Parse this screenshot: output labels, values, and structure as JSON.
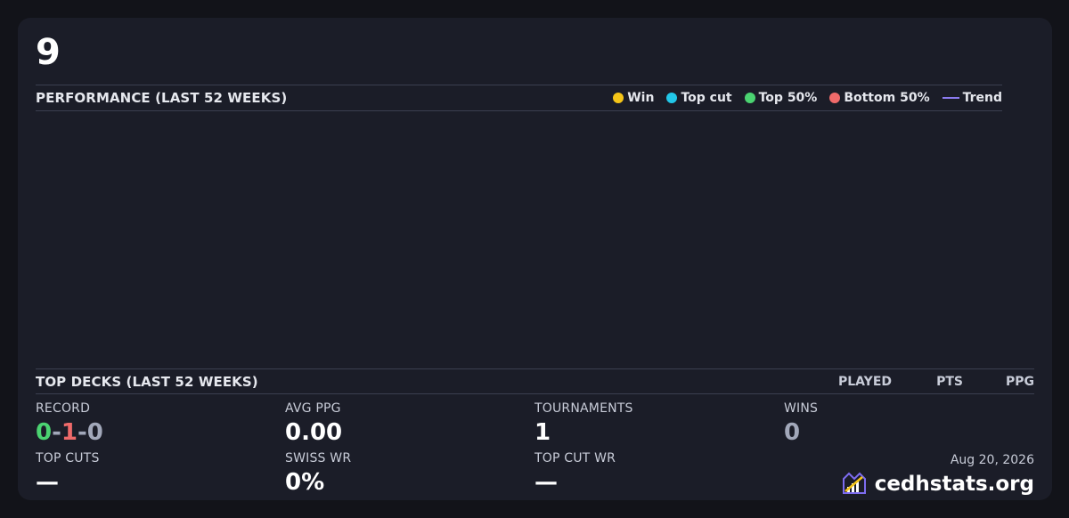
{
  "player": {
    "name": "9"
  },
  "performance": {
    "title": "PERFORMANCE (LAST 52 WEEKS)",
    "legend": [
      {
        "label": "Win",
        "color": "#f5c518",
        "shape": "dot"
      },
      {
        "label": "Top cut",
        "color": "#22c7e8",
        "shape": "dot"
      },
      {
        "label": "Top 50%",
        "color": "#4bd371",
        "shape": "dot"
      },
      {
        "label": "Bottom 50%",
        "color": "#ef6a6a",
        "shape": "dot"
      },
      {
        "label": "Trend",
        "color": "#8b7bf0",
        "shape": "line"
      }
    ]
  },
  "top_decks": {
    "title": "TOP DECKS (LAST 52 WEEKS)",
    "columns": [
      "PLAYED",
      "PTS",
      "PPG"
    ]
  },
  "stats": {
    "record": {
      "label": "RECORD",
      "wins": "0",
      "losses": "1",
      "draws": "0",
      "sep": "-"
    },
    "avg_ppg": {
      "label": "AVG PPG",
      "value": "0.00"
    },
    "tournaments": {
      "label": "TOURNAMENTS",
      "value": "1"
    },
    "wins": {
      "label": "WINS",
      "value": "0"
    },
    "top_cuts": {
      "label": "TOP CUTS",
      "value": "—"
    },
    "swiss_wr": {
      "label": "SWISS WR",
      "value": "0%"
    },
    "top_cut_wr": {
      "label": "TOP CUT WR",
      "value": "—"
    }
  },
  "footer": {
    "date": "Aug 20, 2026",
    "brand": "cedhstats.org"
  }
}
